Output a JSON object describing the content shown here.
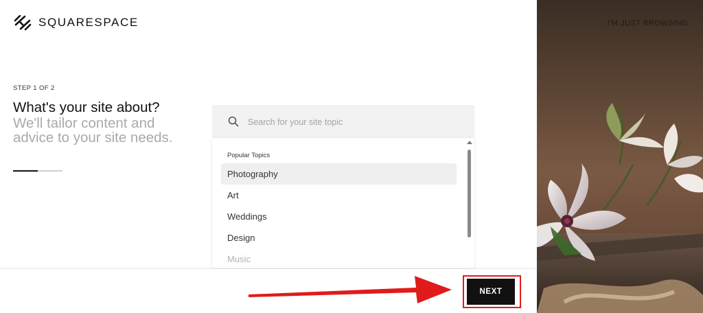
{
  "brand": {
    "name": "SQUARESPACE"
  },
  "header": {
    "browse_link": "I'M JUST BROWSING"
  },
  "intro": {
    "step": "STEP 1 OF 2",
    "question": "What's your site about?",
    "subtext": "We'll tailor content and advice to your site needs.",
    "progress_fraction": 0.5
  },
  "search": {
    "placeholder": "Search for your site topic",
    "value": ""
  },
  "dropdown": {
    "header": "Popular Topics",
    "items": [
      {
        "label": "Photography"
      },
      {
        "label": "Art"
      },
      {
        "label": "Weddings"
      },
      {
        "label": "Design"
      },
      {
        "label": "Music"
      }
    ]
  },
  "footer": {
    "next_label": "NEXT"
  },
  "colors": {
    "accent": "#111111",
    "annotation_red": "#e01b1b",
    "muted_text": "#a9a9a9"
  },
  "icons": {
    "logo": "squarespace-logo-icon",
    "search": "search-icon",
    "scroll": "scroll-up-icon"
  }
}
